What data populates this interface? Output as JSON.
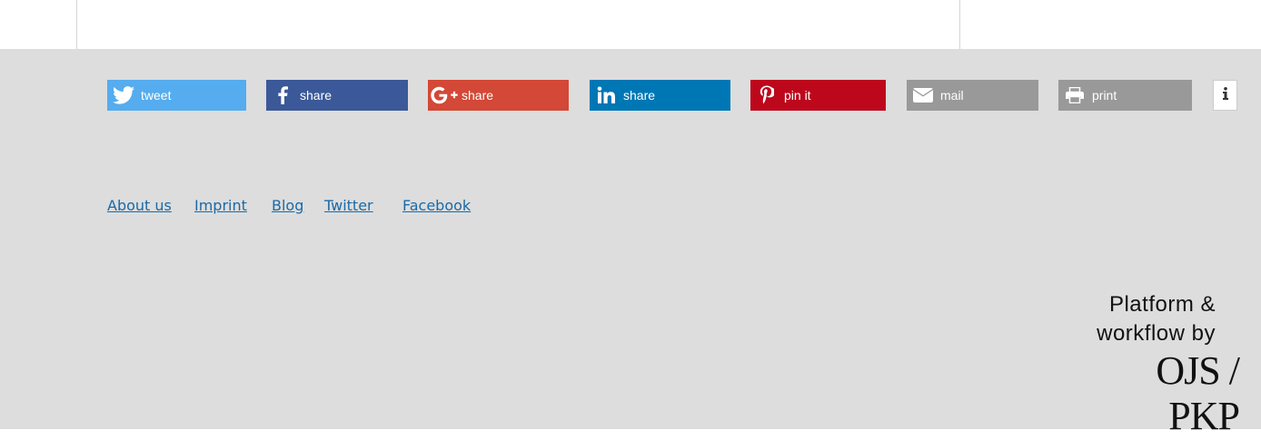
{
  "share_bar": {
    "buttons": [
      {
        "id": "twitter",
        "label": "tweet",
        "icon": "twitter-bird-icon",
        "color": "#55acee"
      },
      {
        "id": "facebook",
        "label": "share",
        "icon": "facebook-f-icon",
        "color": "#3b5998"
      },
      {
        "id": "gplus",
        "label": "share",
        "icon": "google-plus-icon",
        "color": "#d34836"
      },
      {
        "id": "linkedin",
        "label": "share",
        "icon": "linkedin-in-icon",
        "color": "#0077b5"
      },
      {
        "id": "pinterest",
        "label": "pin it",
        "icon": "pinterest-p-icon",
        "color": "#bd081c"
      },
      {
        "id": "mail",
        "label": "mail",
        "icon": "envelope-icon",
        "color": "#999999"
      },
      {
        "id": "print",
        "label": "print",
        "icon": "printer-icon",
        "color": "#999999"
      }
    ],
    "info_icon": "info-icon"
  },
  "footer_links": [
    "About us",
    "Imprint",
    "Blog",
    "Twitter",
    "Facebook"
  ],
  "branding": {
    "line1": "Platform &",
    "line2": "workflow by",
    "logo_text": "OJS / PKP"
  },
  "colors": {
    "footer_bg": "#dddddd",
    "link": "#1a6aa8"
  }
}
